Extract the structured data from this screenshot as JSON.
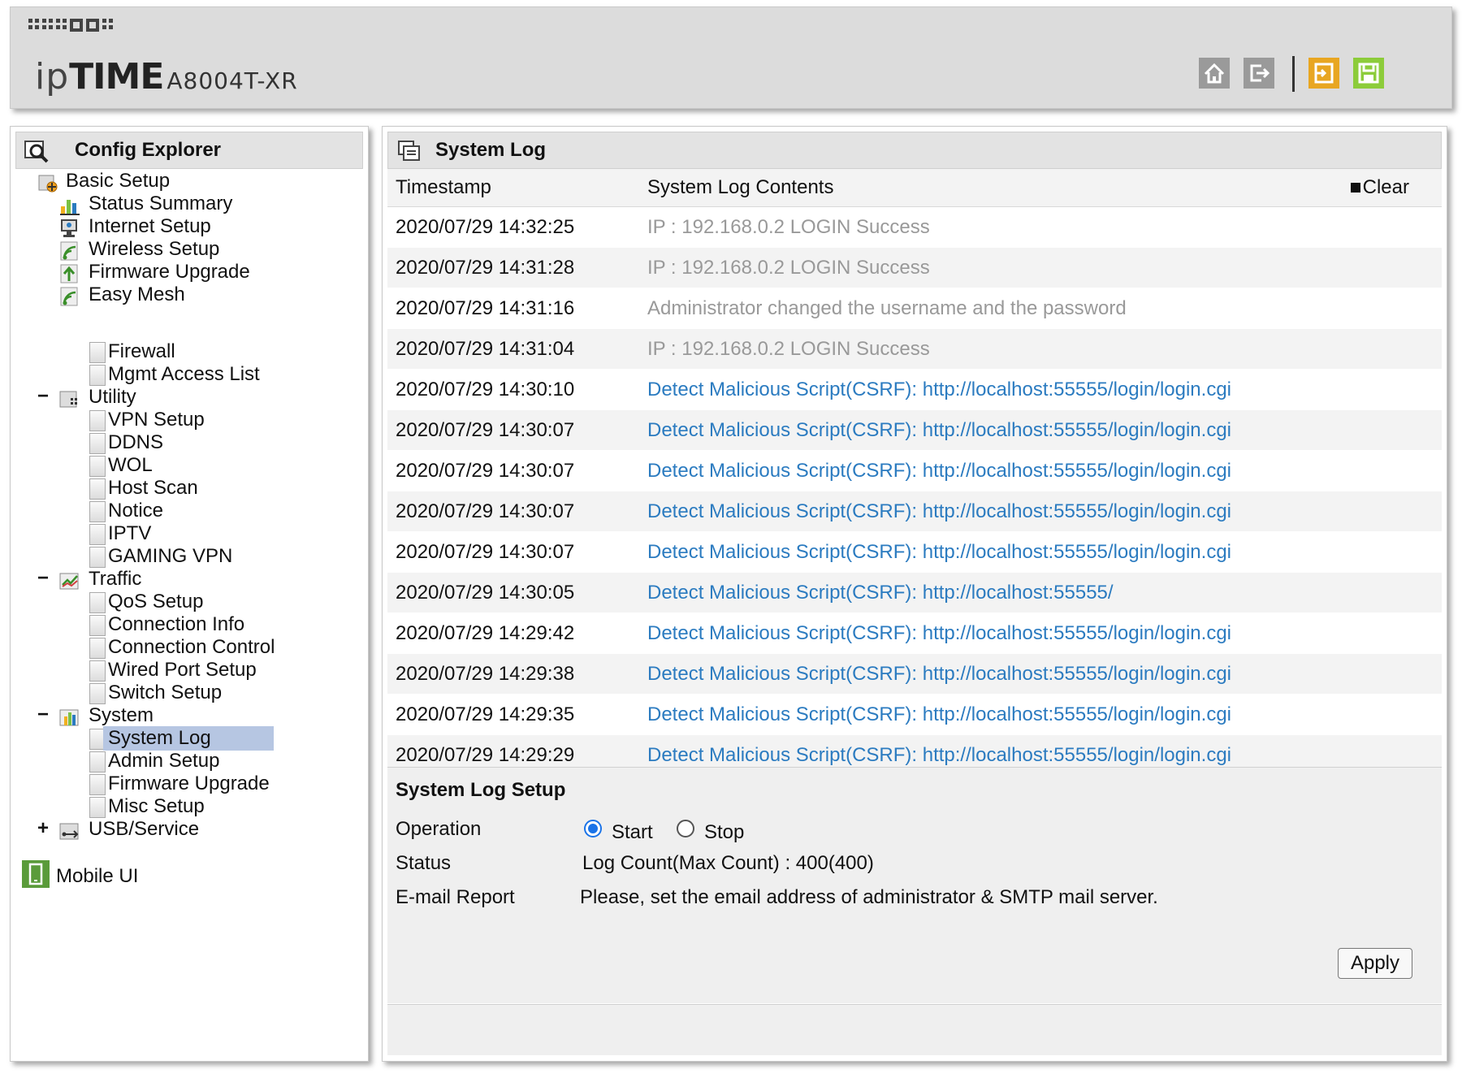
{
  "header": {
    "logo_prefix": "ip",
    "logo_time": "TIME",
    "model": "A8004T-XR"
  },
  "explorer": {
    "title": "Config Explorer",
    "basic_setup": {
      "label": "Basic Setup",
      "items": [
        "Status Summary",
        "Internet Setup",
        "Wireless Setup",
        "Firmware Upgrade",
        "Easy Mesh"
      ]
    },
    "security_items": [
      "Firewall",
      "Mgmt Access List"
    ],
    "utility": {
      "toggle": "−",
      "label": "Utility",
      "items": [
        "VPN Setup",
        "DDNS",
        "WOL",
        "Host Scan",
        "Notice",
        "IPTV",
        "GAMING VPN"
      ]
    },
    "traffic": {
      "toggle": "−",
      "label": "Traffic",
      "items": [
        "QoS Setup",
        "Connection Info",
        "Connection Control",
        "Wired Port Setup",
        "Switch Setup"
      ]
    },
    "system": {
      "toggle": "−",
      "label": "System",
      "items": [
        "System Log",
        "Admin Setup",
        "Firmware Upgrade",
        "Misc Setup"
      ]
    },
    "usb": {
      "toggle": "+",
      "label": "USB/Service"
    },
    "mobile_ui": "Mobile UI"
  },
  "log": {
    "title": "System Log",
    "col_timestamp": "Timestamp",
    "col_contents": "System Log Contents",
    "clear": "Clear",
    "rows": [
      {
        "ts": "2020/07/29 14:32:25",
        "msg": "IP : 192.168.0.2 LOGIN Success",
        "style": "gray"
      },
      {
        "ts": "2020/07/29 14:31:28",
        "msg": "IP : 192.168.0.2 LOGIN Success",
        "style": "gray"
      },
      {
        "ts": "2020/07/29 14:31:16",
        "msg": "Administrator changed the username and the password",
        "style": "gray"
      },
      {
        "ts": "2020/07/29 14:31:04",
        "msg": "IP : 192.168.0.2 LOGIN Success",
        "style": "gray"
      },
      {
        "ts": "2020/07/29 14:30:10",
        "msg": "Detect Malicious Script(CSRF): http://localhost:55555/login/login.cgi",
        "style": "blue"
      },
      {
        "ts": "2020/07/29 14:30:07",
        "msg": "Detect Malicious Script(CSRF): http://localhost:55555/login/login.cgi",
        "style": "blue"
      },
      {
        "ts": "2020/07/29 14:30:07",
        "msg": "Detect Malicious Script(CSRF): http://localhost:55555/login/login.cgi",
        "style": "blue"
      },
      {
        "ts": "2020/07/29 14:30:07",
        "msg": "Detect Malicious Script(CSRF): http://localhost:55555/login/login.cgi",
        "style": "blue"
      },
      {
        "ts": "2020/07/29 14:30:07",
        "msg": "Detect Malicious Script(CSRF): http://localhost:55555/login/login.cgi",
        "style": "blue"
      },
      {
        "ts": "2020/07/29 14:30:05",
        "msg": "Detect Malicious Script(CSRF): http://localhost:55555/",
        "style": "blue"
      },
      {
        "ts": "2020/07/29 14:29:42",
        "msg": "Detect Malicious Script(CSRF): http://localhost:55555/login/login.cgi",
        "style": "blue"
      },
      {
        "ts": "2020/07/29 14:29:38",
        "msg": "Detect Malicious Script(CSRF): http://localhost:55555/login/login.cgi",
        "style": "blue"
      },
      {
        "ts": "2020/07/29 14:29:35",
        "msg": "Detect Malicious Script(CSRF): http://localhost:55555/login/login.cgi",
        "style": "blue"
      },
      {
        "ts": "2020/07/29 14:29:29",
        "msg": "Detect Malicious Script(CSRF): http://localhost:55555/login/login.cgi",
        "style": "blue"
      }
    ]
  },
  "setup": {
    "title": "System Log Setup",
    "operation_label": "Operation",
    "start_label": "Start",
    "stop_label": "Stop",
    "operation_selected": "Start",
    "status_label": "Status",
    "status_value": "Log Count(Max Count) : 400(400)",
    "email_label": "E-mail Report",
    "email_value": "Please, set the email address of administrator & SMTP mail server.",
    "apply_label": "Apply"
  },
  "colors": {
    "log_gray": "#999999",
    "log_blue": "#2b7bc0",
    "selected_bg": "#b6c6e2",
    "brand_green": "#7bc143",
    "restore_orange": "#e8a622",
    "save_green": "#8ccc3a"
  },
  "icons": {
    "home": "home-icon",
    "logout": "logout-icon",
    "restore": "restore-icon",
    "save": "save-icon",
    "explorer": "search-folder-icon",
    "log": "log-window-icon",
    "mobile": "mobile-phone-icon"
  }
}
